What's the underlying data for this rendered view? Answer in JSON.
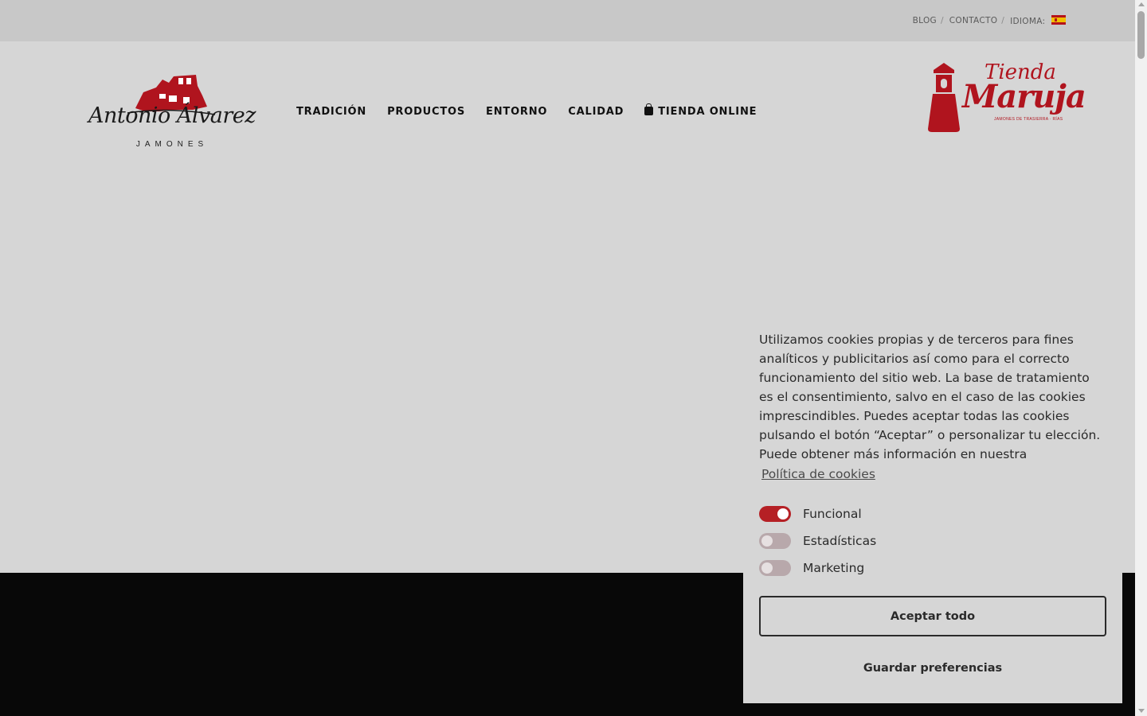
{
  "topbar": {
    "links": [
      {
        "label": "BLOG"
      },
      {
        "label": "CONTACTO"
      }
    ],
    "separator": "/",
    "language_label": "IDIOMA:",
    "language_flag": "spain-flag-icon"
  },
  "header": {
    "logo": {
      "name": "Antonio Álvarez",
      "subtitle": "JAMONES"
    },
    "nav": [
      {
        "label": "TRADICIÓN"
      },
      {
        "label": "PRODUCTOS"
      },
      {
        "label": "ENTORNO"
      },
      {
        "label": "CALIDAD"
      },
      {
        "label": "TIENDA ONLINE",
        "icon": "shopping-bag-icon"
      }
    ],
    "shop_logo": {
      "line1": "Tienda",
      "line2": "Maruja",
      "tagline": "JAMONES DE TRASIERRA · RÍAS"
    }
  },
  "cookie_banner": {
    "text": "Utilizamos cookies propias y de terceros para fines analíticos y publicitarios así como para el correcto funcionamiento del sitio web. La base de tratamiento es el consentimiento, salvo en el caso de las cookies imprescindibles. Puedes aceptar todas las cookies pulsando el botón “Aceptar” o personalizar tu elección. Puede obtener más información en nuestra",
    "policy_link": "Política de cookies",
    "toggles": [
      {
        "label": "Funcional",
        "on": true
      },
      {
        "label": "Estadísticas",
        "on": false
      },
      {
        "label": "Marketing",
        "on": false
      }
    ],
    "accept_label": "Aceptar todo",
    "save_label": "Guardar preferencias"
  },
  "colors": {
    "brand_red": "#b0141e",
    "toggle_on": "#b52025",
    "toggle_off": "#b8a8ab",
    "footer": "#080808"
  }
}
